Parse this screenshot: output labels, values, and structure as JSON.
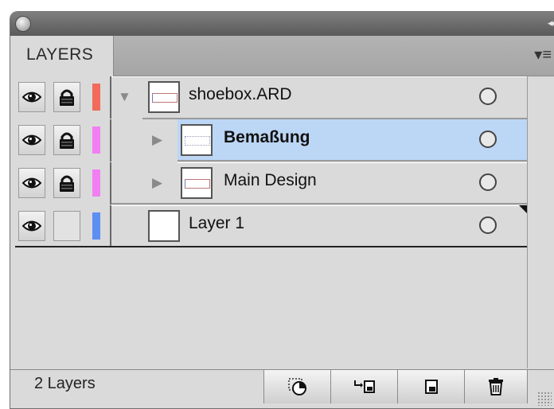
{
  "window": {
    "close_icon": "close-dot-icon",
    "collapse_icon": "double-chevron-icon",
    "collapse_label": "◂◂"
  },
  "tabs": [
    {
      "label": "LAYERS"
    }
  ],
  "panel_menu": {
    "icon": "panel-menu-icon",
    "label": "▾≡"
  },
  "layers": [
    {
      "name": "shoebox.ARD",
      "color": "#f26b5b",
      "visible": true,
      "locked": true,
      "expanded": true,
      "selected": false,
      "level": 0,
      "disclosure": "▼"
    },
    {
      "name": "Bemaßung",
      "color": "#f27ff2",
      "visible": true,
      "locked": true,
      "expanded": false,
      "selected": true,
      "level": 1,
      "disclosure": "▶"
    },
    {
      "name": "Main Design",
      "color": "#f27ff2",
      "visible": true,
      "locked": true,
      "expanded": false,
      "selected": false,
      "level": 1,
      "disclosure": "▶"
    },
    {
      "name": "Layer 1",
      "color": "#5d8ff2",
      "visible": true,
      "locked": false,
      "expanded": false,
      "selected": false,
      "level": 0
    }
  ],
  "footer": {
    "layer_count": "2 Layers",
    "buttons": [
      {
        "name": "make-clipping-mask",
        "icon": "clipping-mask-icon"
      },
      {
        "name": "create-sublayer",
        "icon": "new-sublayer-icon"
      },
      {
        "name": "create-layer",
        "icon": "new-layer-icon"
      },
      {
        "name": "delete",
        "icon": "trash-icon"
      }
    ]
  }
}
